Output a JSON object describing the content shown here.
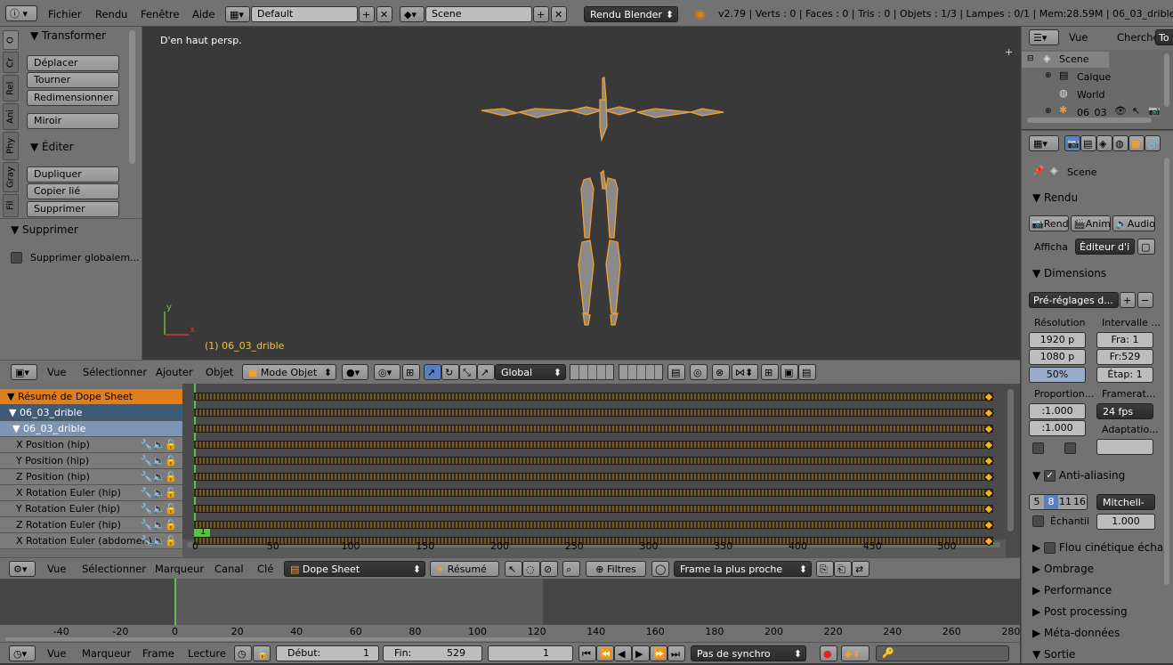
{
  "info_header": {
    "menus": [
      "Fichier",
      "Rendu",
      "Fenêtre",
      "Aide"
    ],
    "layout": "Default",
    "scene": "Scene",
    "engine": "Rendu Blender",
    "stats": "v2.79 | Verts : 0 | Faces : 0 | Tris : 0 | Objets : 1/3 | Lampes : 0/1 | Mem:28.59M | 06_03_drible"
  },
  "tool_shelf": {
    "tabs": [
      "O",
      "Cr",
      "Rel",
      "Ani",
      "Phy",
      "Gray",
      "Fil"
    ],
    "transform_title": "Transformer",
    "transform_buttons": [
      "Déplacer",
      "Tourner",
      "Redimensionner"
    ],
    "mirror": "Miroir",
    "edit_title": "Éditer",
    "edit_buttons": [
      "Dupliquer",
      "Copier lié",
      "Supprimer"
    ],
    "delete_title": "Supprimer",
    "delete_option": "Supprimer globalem..."
  },
  "viewport": {
    "view_label": "D'en haut persp.",
    "object_label": "(1) 06_03_drible",
    "axis_y": "y",
    "axis_x": "x"
  },
  "view3d_header": {
    "menus": [
      "Vue",
      "Sélectionner",
      "Ajouter",
      "Objet"
    ],
    "mode": "Mode Objet",
    "orientation": "Global"
  },
  "dopesheet": {
    "channels": [
      {
        "label": "Résumé de Dope Sheet",
        "kind": "summary"
      },
      {
        "label": "06_03_drible",
        "kind": "object"
      },
      {
        "label": "06_03_drible",
        "kind": "action"
      },
      {
        "label": "X Position (hip)",
        "kind": "fcurve"
      },
      {
        "label": "Y Position (hip)",
        "kind": "fcurve"
      },
      {
        "label": "Z Position (hip)",
        "kind": "fcurve"
      },
      {
        "label": "X Rotation Euler (hip)",
        "kind": "fcurve"
      },
      {
        "label": "Y Rotation Euler (hip)",
        "kind": "fcurve"
      },
      {
        "label": "Z Rotation Euler (hip)",
        "kind": "fcurve"
      },
      {
        "label": "X Rotation Euler (abdomen)",
        "kind": "fcurve"
      }
    ],
    "current_frame": "1",
    "ruler": [
      "0",
      "50",
      "100",
      "150",
      "200",
      "250",
      "300",
      "350",
      "400",
      "450",
      "500"
    ]
  },
  "dopesheet_header": {
    "menus": [
      "Vue",
      "Sélectionner",
      "Marqueur",
      "Canal",
      "Clé"
    ],
    "mode": "Dope Sheet",
    "summary": "Résumé",
    "filters": "Filtres",
    "snap": "Frame la plus proche"
  },
  "timeline": {
    "ruler": [
      "-40",
      "-20",
      "0",
      "20",
      "40",
      "60",
      "80",
      "100",
      "120",
      "140",
      "160",
      "180",
      "200",
      "220",
      "240",
      "260",
      "280"
    ]
  },
  "timeline_header": {
    "menus": [
      "Vue",
      "Marqueur",
      "Frame",
      "Lecture"
    ],
    "start_label": "Début:",
    "start_value": "1",
    "end_label": "Fin:",
    "end_value": "529",
    "current": "1",
    "sync": "Pas de synchro"
  },
  "outliner": {
    "menus": [
      "Vue",
      "Chercher"
    ],
    "tab": "To",
    "items": [
      "Scene",
      "Calque",
      "World",
      "06_03"
    ]
  },
  "properties": {
    "context": "Scene",
    "render_title": "Rendu",
    "render_buttons": [
      "Rendu",
      "Anim",
      "Audio"
    ],
    "display_label": "Afficha",
    "display_value": "Éditeur d'i",
    "dimensions_title": "Dimensions",
    "presets": "Pré-réglages d...",
    "resolution_label": "Résolution",
    "res_x": "1920 p",
    "res_y": "1080 p",
    "res_pct": "50%",
    "range_label": "Intervalle ...",
    "frame_start": "Fra:  1",
    "frame_end": "Fr:529",
    "frame_step": "Étap: 1",
    "aspect_label": "Proportion...",
    "aspect_x": ":1.000",
    "aspect_y": ":1.000",
    "framerate_label": "Framerat...",
    "framerate": "24 fps",
    "adapt_label": "Adaptatio...",
    "aa_title": "Anti-aliasing",
    "aa_samples": [
      "5",
      "8",
      "11",
      "16"
    ],
    "aa_filter": "Mitchell-",
    "aa_full": "Échantil",
    "aa_size": "1.000",
    "collapsed": [
      "Flou cinétique échan",
      "Ombrage",
      "Performance",
      "Post processing",
      "Méta-données",
      "Sortie"
    ]
  }
}
